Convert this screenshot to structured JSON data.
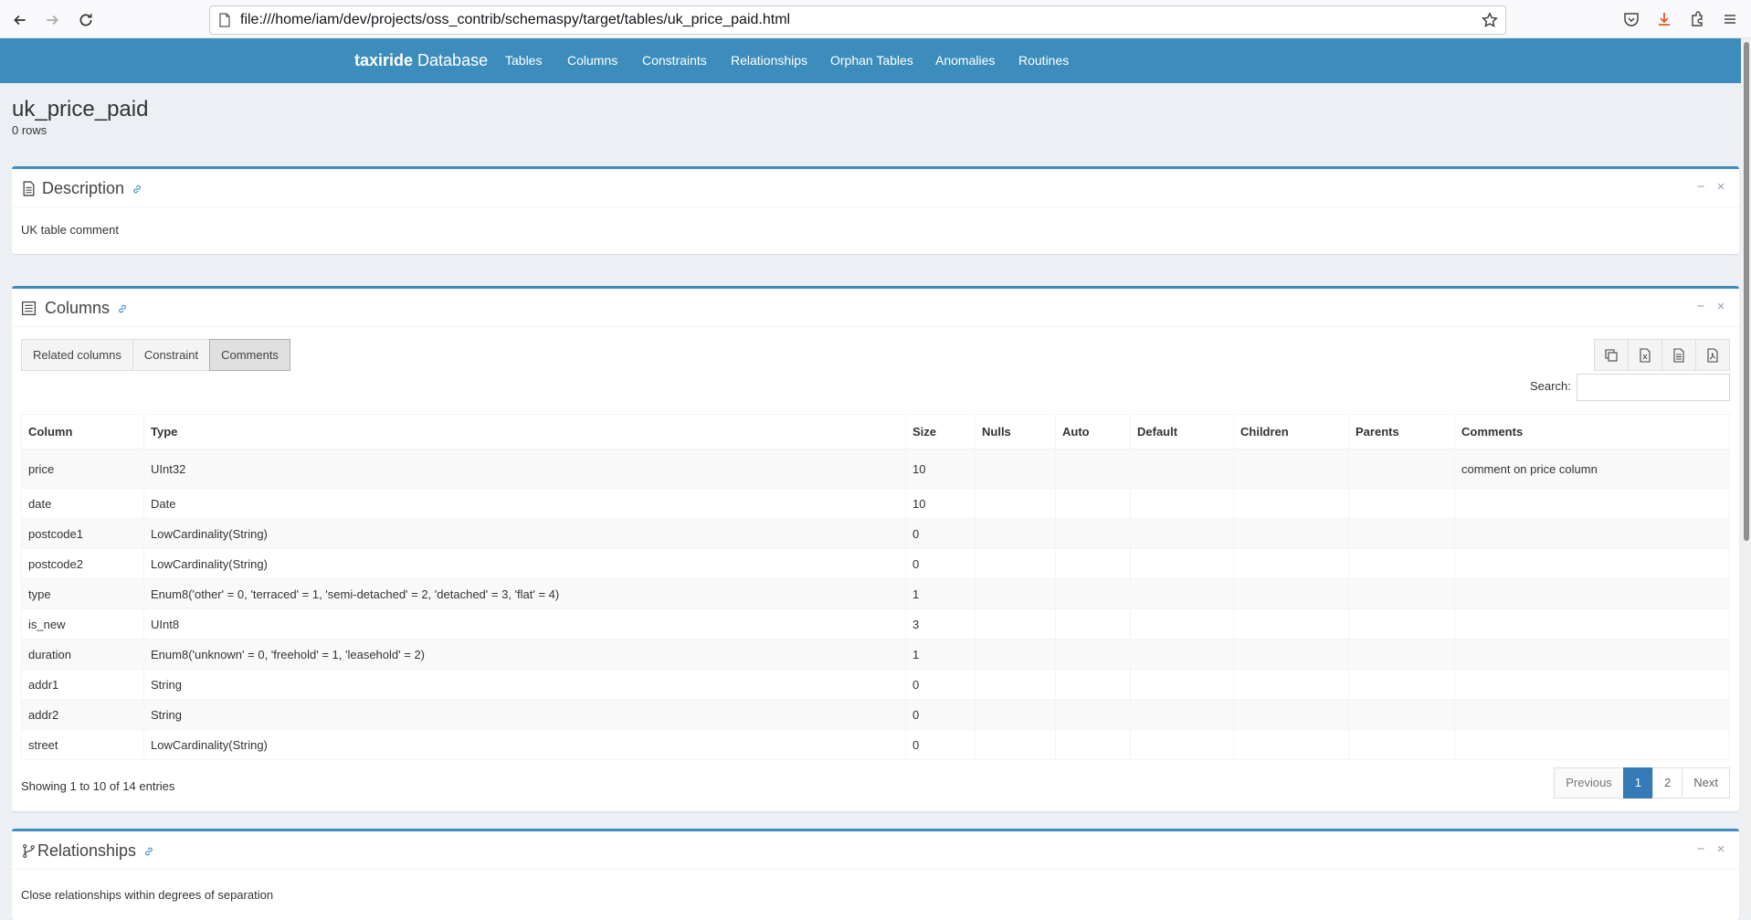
{
  "browser": {
    "url": "file:///home/iam/dev/projects/oss_contrib/schemaspy/target/tables/uk_price_paid.html"
  },
  "navbar": {
    "brand_bold": "taxiride",
    "brand_rest": " Database",
    "items": [
      "Tables",
      "Columns",
      "Constraints",
      "Relationships",
      "Orphan Tables",
      "Anomalies",
      "Routines"
    ]
  },
  "page": {
    "title": "uk_price_paid",
    "rows": "0 rows"
  },
  "description_box": {
    "title": "Description",
    "text": "UK table comment"
  },
  "columns_box": {
    "title": "Columns",
    "toggle_buttons": [
      "Related columns",
      "Constraint",
      "Comments"
    ],
    "search_label": "Search:",
    "headers": [
      "Column",
      "Type",
      "Size",
      "Nulls",
      "Auto",
      "Default",
      "Children",
      "Parents",
      "Comments"
    ],
    "rows": [
      [
        "price",
        "UInt32",
        "10",
        "",
        "",
        "",
        "",
        "",
        "comment on price column"
      ],
      [
        "date",
        "Date",
        "10",
        "",
        "",
        "",
        "",
        "",
        ""
      ],
      [
        "postcode1",
        "LowCardinality(String)",
        "0",
        "",
        "",
        "",
        "",
        "",
        ""
      ],
      [
        "postcode2",
        "LowCardinality(String)",
        "0",
        "",
        "",
        "",
        "",
        "",
        ""
      ],
      [
        "type",
        "Enum8('other' = 0, 'terraced' = 1, 'semi-detached' = 2, 'detached' = 3, 'flat' = 4)",
        "1",
        "",
        "",
        "",
        "",
        "",
        ""
      ],
      [
        "is_new",
        "UInt8",
        "3",
        "",
        "",
        "",
        "",
        "",
        ""
      ],
      [
        "duration",
        "Enum8('unknown' = 0, 'freehold' = 1, 'leasehold' = 2)",
        "1",
        "",
        "",
        "",
        "",
        "",
        ""
      ],
      [
        "addr1",
        "String",
        "0",
        "",
        "",
        "",
        "",
        "",
        ""
      ],
      [
        "addr2",
        "String",
        "0",
        "",
        "",
        "",
        "",
        "",
        ""
      ],
      [
        "street",
        "LowCardinality(String)",
        "0",
        "",
        "",
        "",
        "",
        "",
        ""
      ]
    ],
    "showing": "Showing 1 to 10 of 14 entries",
    "pagination": [
      "Previous",
      "1",
      "2",
      "Next"
    ]
  },
  "relationships_box": {
    "title": "Relationships",
    "text": "Close relationships within degrees of separation"
  },
  "colors": {
    "primary": "#3c8dbc",
    "background": "#ecf0f5",
    "page_active": "#337ab7"
  }
}
